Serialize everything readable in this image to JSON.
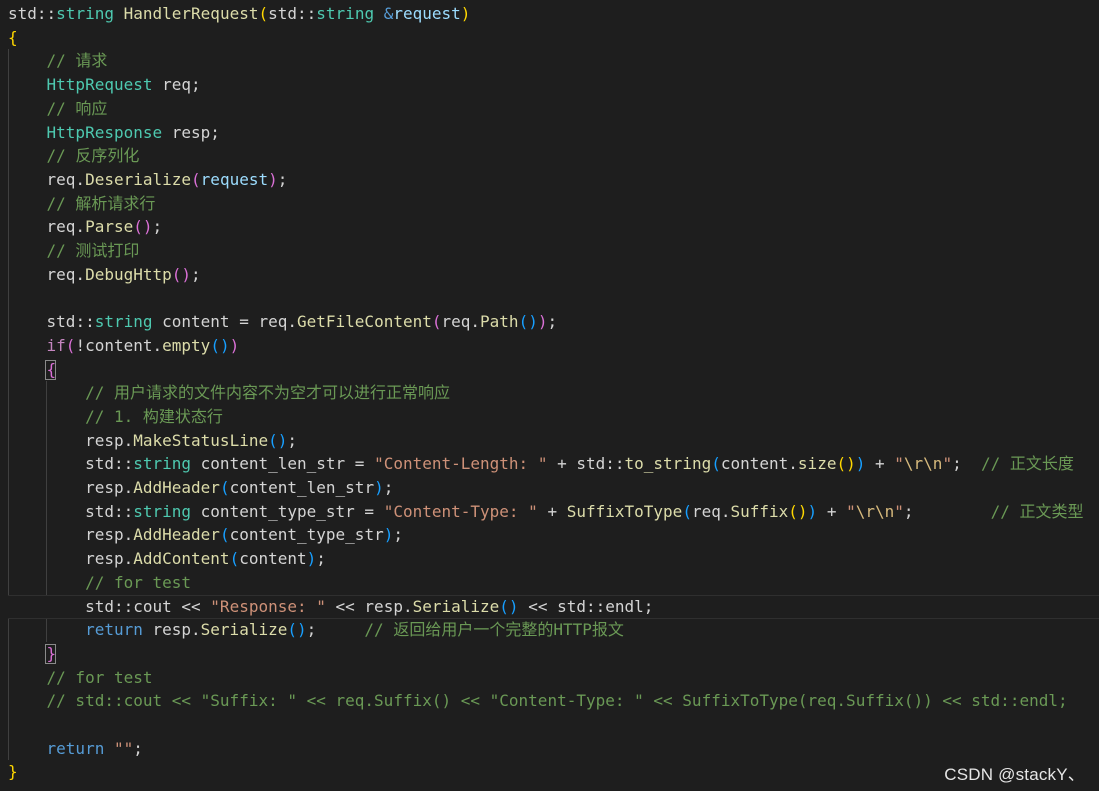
{
  "editor": {
    "theme_colors": {
      "background": "#1e1e1e",
      "plain": "#d4d4d4",
      "type": "#4ec9b0",
      "keyword": "#569cd6",
      "control": "#c586c0",
      "function": "#dcdcaa",
      "variable": "#9cdcfe",
      "string": "#ce9178",
      "escape": "#d7ba7d",
      "comment": "#6a9955",
      "bracket_level1": "#ffd700",
      "bracket_level2": "#da70d6",
      "bracket_level3": "#179fff"
    },
    "current_line_index": 25,
    "lines": [
      [
        [
          "std",
          "t-plain"
        ],
        [
          "::",
          "t-plain"
        ],
        [
          "string",
          "t-type"
        ],
        [
          " ",
          "t-plain"
        ],
        [
          "HandlerRequest",
          "t-fn"
        ],
        [
          "(",
          "t-b1"
        ],
        [
          "std",
          "t-plain"
        ],
        [
          "::",
          "t-plain"
        ],
        [
          "string",
          "t-type"
        ],
        [
          " ",
          "t-plain"
        ],
        [
          "&",
          "t-kw"
        ],
        [
          "request",
          "t-param"
        ],
        [
          ")",
          "t-b1"
        ]
      ],
      [
        [
          "{",
          "t-b1"
        ]
      ],
      [
        [
          "    ",
          "t-plain"
        ],
        [
          "// 请求",
          "t-cmt"
        ]
      ],
      [
        [
          "    ",
          "t-plain"
        ],
        [
          "HttpRequest",
          "t-type"
        ],
        [
          " req;",
          "t-plain"
        ]
      ],
      [
        [
          "    ",
          "t-plain"
        ],
        [
          "// 响应",
          "t-cmt"
        ]
      ],
      [
        [
          "    ",
          "t-plain"
        ],
        [
          "HttpResponse",
          "t-type"
        ],
        [
          " resp;",
          "t-plain"
        ]
      ],
      [
        [
          "    ",
          "t-plain"
        ],
        [
          "// 反序列化",
          "t-cmt"
        ]
      ],
      [
        [
          "    ",
          "t-plain"
        ],
        [
          "req.",
          "t-plain"
        ],
        [
          "Deserialize",
          "t-fn"
        ],
        [
          "(",
          "t-b2"
        ],
        [
          "request",
          "t-param"
        ],
        [
          ")",
          "t-b2"
        ],
        [
          ";",
          "t-plain"
        ]
      ],
      [
        [
          "    ",
          "t-plain"
        ],
        [
          "// 解析请求行",
          "t-cmt"
        ]
      ],
      [
        [
          "    ",
          "t-plain"
        ],
        [
          "req.",
          "t-plain"
        ],
        [
          "Parse",
          "t-fn"
        ],
        [
          "()",
          "t-b2"
        ],
        [
          ";",
          "t-plain"
        ]
      ],
      [
        [
          "    ",
          "t-plain"
        ],
        [
          "// 测试打印",
          "t-cmt"
        ]
      ],
      [
        [
          "    ",
          "t-plain"
        ],
        [
          "req.",
          "t-plain"
        ],
        [
          "DebugHttp",
          "t-fn"
        ],
        [
          "()",
          "t-b2"
        ],
        [
          ";",
          "t-plain"
        ]
      ],
      [
        [
          "",
          "t-plain"
        ]
      ],
      [
        [
          "    ",
          "t-plain"
        ],
        [
          "std",
          "t-plain"
        ],
        [
          "::",
          "t-plain"
        ],
        [
          "string",
          "t-type"
        ],
        [
          " content = req.",
          "t-plain"
        ],
        [
          "GetFileContent",
          "t-fn"
        ],
        [
          "(",
          "t-b2"
        ],
        [
          "req.",
          "t-plain"
        ],
        [
          "Path",
          "t-fn"
        ],
        [
          "()",
          "t-b3"
        ],
        [
          ")",
          "t-b2"
        ],
        [
          ";",
          "t-plain"
        ]
      ],
      [
        [
          "    ",
          "t-plain"
        ],
        [
          "if",
          "t-ctrl"
        ],
        [
          "(",
          "t-b2"
        ],
        [
          "!content.",
          "t-plain"
        ],
        [
          "empty",
          "t-fn"
        ],
        [
          "()",
          "t-b3"
        ],
        [
          ")",
          "t-b2"
        ]
      ],
      [
        [
          "    ",
          "t-plain"
        ],
        [
          "{",
          "t-b2"
        ]
      ],
      [
        [
          "        ",
          "t-plain"
        ],
        [
          "// 用户请求的文件内容不为空才可以进行正常响应",
          "t-cmt"
        ]
      ],
      [
        [
          "        ",
          "t-plain"
        ],
        [
          "// 1. 构建状态行",
          "t-cmt"
        ]
      ],
      [
        [
          "        ",
          "t-plain"
        ],
        [
          "resp.",
          "t-plain"
        ],
        [
          "MakeStatusLine",
          "t-fn"
        ],
        [
          "()",
          "t-b3"
        ],
        [
          ";",
          "t-plain"
        ]
      ],
      [
        [
          "        ",
          "t-plain"
        ],
        [
          "std",
          "t-plain"
        ],
        [
          "::",
          "t-plain"
        ],
        [
          "string",
          "t-type"
        ],
        [
          " content_len_str = ",
          "t-plain"
        ],
        [
          "\"Content-Length: \"",
          "t-str"
        ],
        [
          " + std::",
          "t-plain"
        ],
        [
          "to_string",
          "t-fn"
        ],
        [
          "(",
          "t-b3"
        ],
        [
          "content.",
          "t-plain"
        ],
        [
          "size",
          "t-fn"
        ],
        [
          "()",
          "t-b1"
        ],
        [
          ")",
          "t-b3"
        ],
        [
          " + ",
          "t-plain"
        ],
        [
          "\"",
          "t-str"
        ],
        [
          "\\r\\n",
          "t-esc"
        ],
        [
          "\"",
          "t-str"
        ],
        [
          ";  ",
          "t-plain"
        ],
        [
          "// 正文长度",
          "t-cmt"
        ]
      ],
      [
        [
          "        ",
          "t-plain"
        ],
        [
          "resp.",
          "t-plain"
        ],
        [
          "AddHeader",
          "t-fn"
        ],
        [
          "(",
          "t-b3"
        ],
        [
          "content_len_str",
          "t-plain"
        ],
        [
          ")",
          "t-b3"
        ],
        [
          ";",
          "t-plain"
        ]
      ],
      [
        [
          "        ",
          "t-plain"
        ],
        [
          "std",
          "t-plain"
        ],
        [
          "::",
          "t-plain"
        ],
        [
          "string",
          "t-type"
        ],
        [
          " content_type_str = ",
          "t-plain"
        ],
        [
          "\"Content-Type: \"",
          "t-str"
        ],
        [
          " + ",
          "t-plain"
        ],
        [
          "SuffixToType",
          "t-fn"
        ],
        [
          "(",
          "t-b3"
        ],
        [
          "req.",
          "t-plain"
        ],
        [
          "Suffix",
          "t-fn"
        ],
        [
          "()",
          "t-b1"
        ],
        [
          ")",
          "t-b3"
        ],
        [
          " + ",
          "t-plain"
        ],
        [
          "\"",
          "t-str"
        ],
        [
          "\\r\\n",
          "t-esc"
        ],
        [
          "\"",
          "t-str"
        ],
        [
          ";        ",
          "t-plain"
        ],
        [
          "// 正文类型",
          "t-cmt"
        ]
      ],
      [
        [
          "        ",
          "t-plain"
        ],
        [
          "resp.",
          "t-plain"
        ],
        [
          "AddHeader",
          "t-fn"
        ],
        [
          "(",
          "t-b3"
        ],
        [
          "content_type_str",
          "t-plain"
        ],
        [
          ")",
          "t-b3"
        ],
        [
          ";",
          "t-plain"
        ]
      ],
      [
        [
          "        ",
          "t-plain"
        ],
        [
          "resp.",
          "t-plain"
        ],
        [
          "AddContent",
          "t-fn"
        ],
        [
          "(",
          "t-b3"
        ],
        [
          "content",
          "t-plain"
        ],
        [
          ")",
          "t-b3"
        ],
        [
          ";",
          "t-plain"
        ]
      ],
      [
        [
          "        ",
          "t-plain"
        ],
        [
          "// for test",
          "t-cmt"
        ]
      ],
      [
        [
          "        ",
          "t-plain"
        ],
        [
          "std::cout << ",
          "t-plain"
        ],
        [
          "\"Response: \"",
          "t-str"
        ],
        [
          " << resp.",
          "t-plain"
        ],
        [
          "Serialize",
          "t-fn"
        ],
        [
          "()",
          "t-b3"
        ],
        [
          " << std::endl;",
          "t-plain"
        ]
      ],
      [
        [
          "        ",
          "t-plain"
        ],
        [
          "return",
          "t-kw"
        ],
        [
          " resp.",
          "t-plain"
        ],
        [
          "Serialize",
          "t-fn"
        ],
        [
          "()",
          "t-b3"
        ],
        [
          ";     ",
          "t-plain"
        ],
        [
          "// 返回给用户一个完整的HTTP报文",
          "t-cmt"
        ]
      ],
      [
        [
          "    ",
          "t-plain"
        ],
        [
          "}",
          "t-b2"
        ]
      ],
      [
        [
          "    ",
          "t-plain"
        ],
        [
          "// for test",
          "t-cmt"
        ]
      ],
      [
        [
          "    ",
          "t-plain"
        ],
        [
          "// std::cout << \"Suffix: \" << req.Suffix() << \"Content-Type: \" << SuffixToType(req.Suffix()) << std::endl;",
          "t-cmt"
        ]
      ],
      [
        [
          "",
          "t-plain"
        ]
      ],
      [
        [
          "    ",
          "t-plain"
        ],
        [
          "return",
          "t-kw"
        ],
        [
          " ",
          "t-plain"
        ],
        [
          "\"\"",
          "t-str"
        ],
        [
          ";",
          "t-plain"
        ]
      ],
      [
        [
          "}",
          "t-b1"
        ]
      ]
    ]
  },
  "watermark": {
    "text": "CSDN @stackY、"
  }
}
